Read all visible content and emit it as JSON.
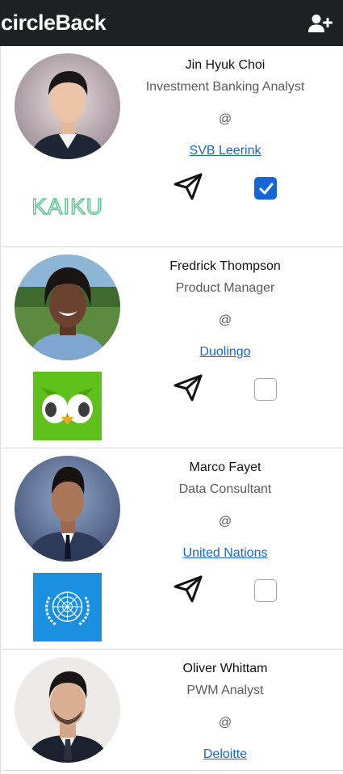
{
  "app": {
    "brand": "circleBack",
    "add_contact_icon": "user-plus-icon"
  },
  "colors": {
    "navbar_bg": "#1f2023",
    "link": "#1565d8",
    "checkbox_checked": "#1566d6"
  },
  "contacts": [
    {
      "name": "Jin Hyuk Choi",
      "title": "Investment Banking Analyst",
      "at": "@",
      "company": "SVB Leerink",
      "logo_text": "KAIKU",
      "send_icon": "paper-plane-icon",
      "selected": true
    },
    {
      "name": "Fredrick Thompson",
      "title": "Product Manager",
      "at": "@",
      "company": "Duolingo",
      "logo_icon": "duolingo-owl-logo",
      "send_icon": "paper-plane-icon",
      "selected": false
    },
    {
      "name": "Marco Fayet",
      "title": "Data Consultant",
      "at": "@",
      "company": "United Nations",
      "logo_icon": "un-emblem-logo",
      "send_icon": "paper-plane-icon",
      "selected": false
    },
    {
      "name": "Oliver Whittam",
      "title": "PWM Analyst",
      "at": "@",
      "company": "Deloitte"
    }
  ]
}
